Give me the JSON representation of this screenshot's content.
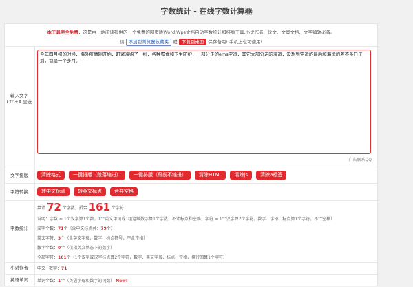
{
  "page_title": "字数统计 - 在线字数计算器",
  "intro": {
    "free_text": "本工具完全免费",
    "description": "，这是由一站阅读提供的一个免费的网页版Word,Wps文档自动字数统计和排版工具,小说作者、论文、文案文档、文字编辑必备。",
    "please": "请",
    "bookmark_button": "添加到浏览器收藏夹",
    "or": "或",
    "download_button": "下载到桌面",
    "save_text": "保存备用!  手机上也可使用!"
  },
  "input": {
    "label_line1": "输入文字",
    "label_line2": "Ctrl+A 全选",
    "value": "今年四月初的时候，海外疫情刚开始，赶紧海购了一批，各种零食和卫生防护，一部分走的ems空运，其它大部分走的海运，没想到空运的最后和海运的差不多日子到，都是一个多月。"
  },
  "ad_link": "广告联系QQ",
  "layout_row": {
    "label": "文字排版",
    "buttons": [
      "清除格式",
      "一键排版（段落缩进）",
      "一键排版（段前不缩进）",
      "清除HTML",
      "清除js",
      "清除a标签"
    ]
  },
  "convert_row": {
    "label": "字符转换",
    "buttons": [
      "转中文标点",
      "转英文标点",
      "合并空格"
    ]
  },
  "stats": {
    "label": "字数统计",
    "total_prefix": "共计",
    "total_words": "72",
    "total_mid": "个字数，折合",
    "total_chars": "161",
    "total_suffix": "个字符",
    "explain": "说明：字数 = 1个汉字算1个数，1个英文单词或1组连续数字算1个字数，不计标点和空格；字符 = 1个汉字算2个字符，数字、字母、标点算1个字符，不计空格）",
    "han_label": "汉字个数：",
    "han_count": "71",
    "han_mid": "个（含中文标点共：",
    "han_with_punct": "79",
    "han_suffix": "个）",
    "en_label": "英文字符：",
    "en_count": "3",
    "en_note": "个（含英文字母、数字、标点符号，不含空格）",
    "num_label": "数字个数：",
    "num_count": "0",
    "num_note": "个（仅指英文状态下的数字）",
    "all_label": "全部字符：",
    "all_count": "161",
    "all_note": "个（1个汉字或汉字标点算2个字符，数字、英文字母、标点、空格、换行回算1个字符）"
  },
  "novel": {
    "label": "小说作者",
    "text": "中文+数字：",
    "value": "71"
  },
  "english": {
    "label": "英语单词",
    "text": "单词个数：",
    "value": "1",
    "note": "个（英语字母和数字的词数）",
    "new_badge": "New!"
  }
}
